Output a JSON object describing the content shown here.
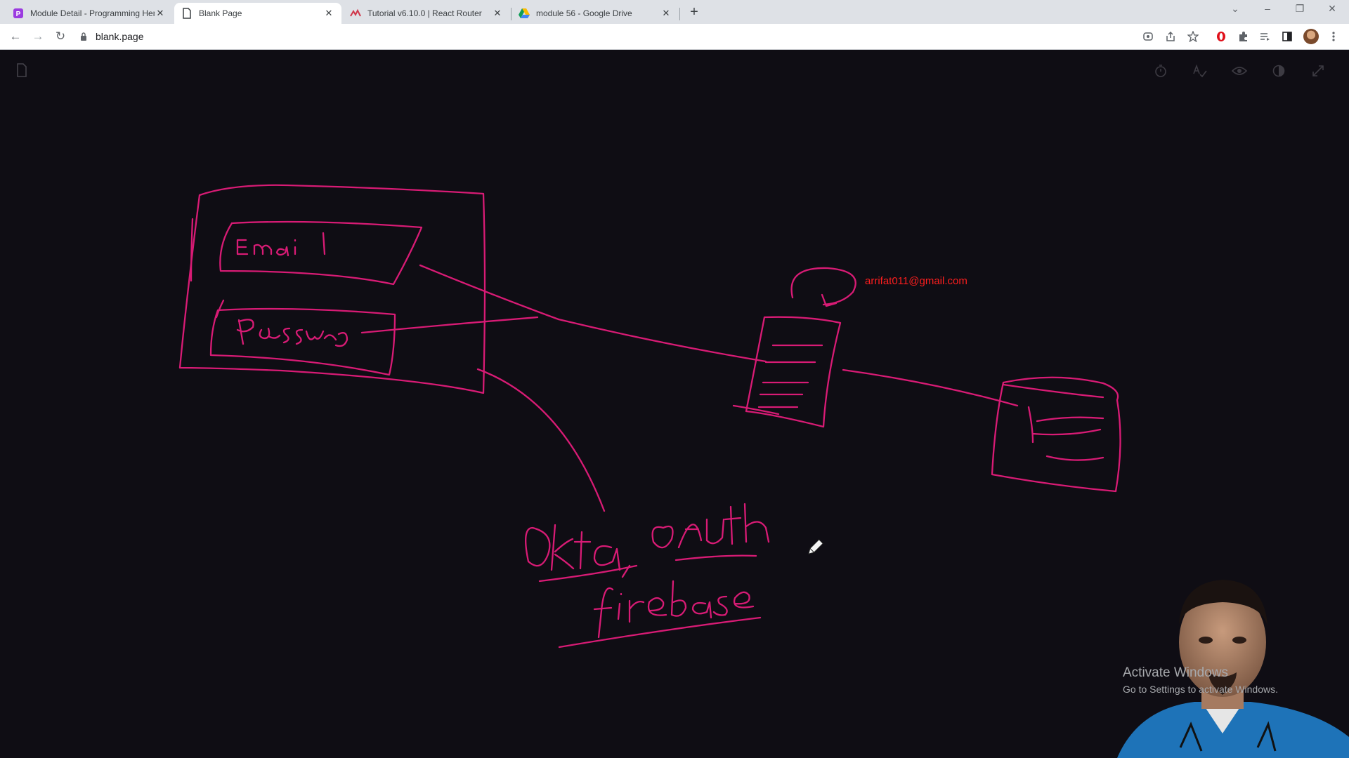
{
  "browser": {
    "tabs": [
      {
        "title": "Module Detail - Programming Hero",
        "icon": "programming-hero-icon",
        "active": false
      },
      {
        "title": "Blank Page",
        "icon": "page-icon",
        "active": true
      },
      {
        "title": "Tutorial v6.10.0 | React Router",
        "icon": "react-router-icon",
        "active": false
      },
      {
        "title": "module 56 - Google Drive",
        "icon": "google-drive-icon",
        "active": false
      }
    ],
    "address": "blank.page",
    "accent_colors": {
      "tabstrip": "#dee1e6",
      "toolbar": "#ffffff"
    }
  },
  "app": {
    "background": "#0f0d14",
    "ink_color": "#d81b75",
    "tools": [
      "timer-icon",
      "spellcheck-icon",
      "eye-icon",
      "contrast-icon",
      "fullscreen-icon"
    ]
  },
  "drawing": {
    "handwritten_labels": [
      "Email",
      "Password",
      "Okta, oAuth",
      "firebase"
    ]
  },
  "overlay": {
    "email": "arrifat011@gmail.com",
    "watermark_line1": "Activate Windows",
    "watermark_line2": "Go to Settings to activate Windows."
  }
}
